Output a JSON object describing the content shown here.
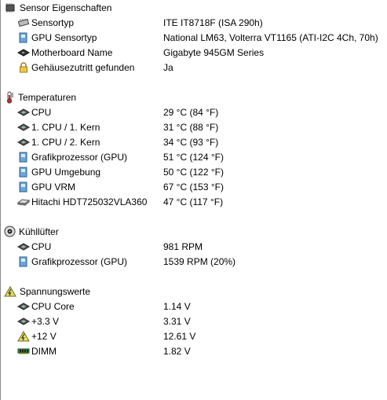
{
  "sections": {
    "sensor": {
      "title": "Sensor Eigenschaften",
      "rows": [
        {
          "field": "Sensortyp",
          "value": "ITE IT8718F  (ISA 290h)"
        },
        {
          "field": "GPU Sensortyp",
          "value": "National LM63, Volterra VT1165  (ATI-I2C 4Ch, 70h)"
        },
        {
          "field": "Motherboard Name",
          "value": "Gigabyte 945GM Series"
        },
        {
          "field": "Gehäusezutritt gefunden",
          "value": "Ja"
        }
      ]
    },
    "temperatures": {
      "title": "Temperaturen",
      "rows": [
        {
          "field": "CPU",
          "value": "29 °C  (84 °F)"
        },
        {
          "field": "1. CPU / 1. Kern",
          "value": "31 °C  (88 °F)"
        },
        {
          "field": "1. CPU / 2. Kern",
          "value": "34 °C  (93 °F)"
        },
        {
          "field": "Grafikprozessor (GPU)",
          "value": "51 °C  (124 °F)"
        },
        {
          "field": "GPU Umgebung",
          "value": "50 °C  (122 °F)"
        },
        {
          "field": "GPU VRM",
          "value": "67 °C  (153 °F)"
        },
        {
          "field": "Hitachi HDT725032VLA360",
          "value": "47 °C  (117 °F)"
        }
      ]
    },
    "fans": {
      "title": "Kühllüfter",
      "rows": [
        {
          "field": "CPU",
          "value": "981 RPM"
        },
        {
          "field": "Grafikprozessor (GPU)",
          "value": "1539 RPM  (20%)"
        }
      ]
    },
    "voltages": {
      "title": "Spannungswerte",
      "rows": [
        {
          "field": "CPU Core",
          "value": "1.14 V"
        },
        {
          "field": "+3.3 V",
          "value": "3.31 V"
        },
        {
          "field": "+12 V",
          "value": "12.61 V"
        },
        {
          "field": "DIMM",
          "value": "1.82 V"
        }
      ]
    }
  }
}
